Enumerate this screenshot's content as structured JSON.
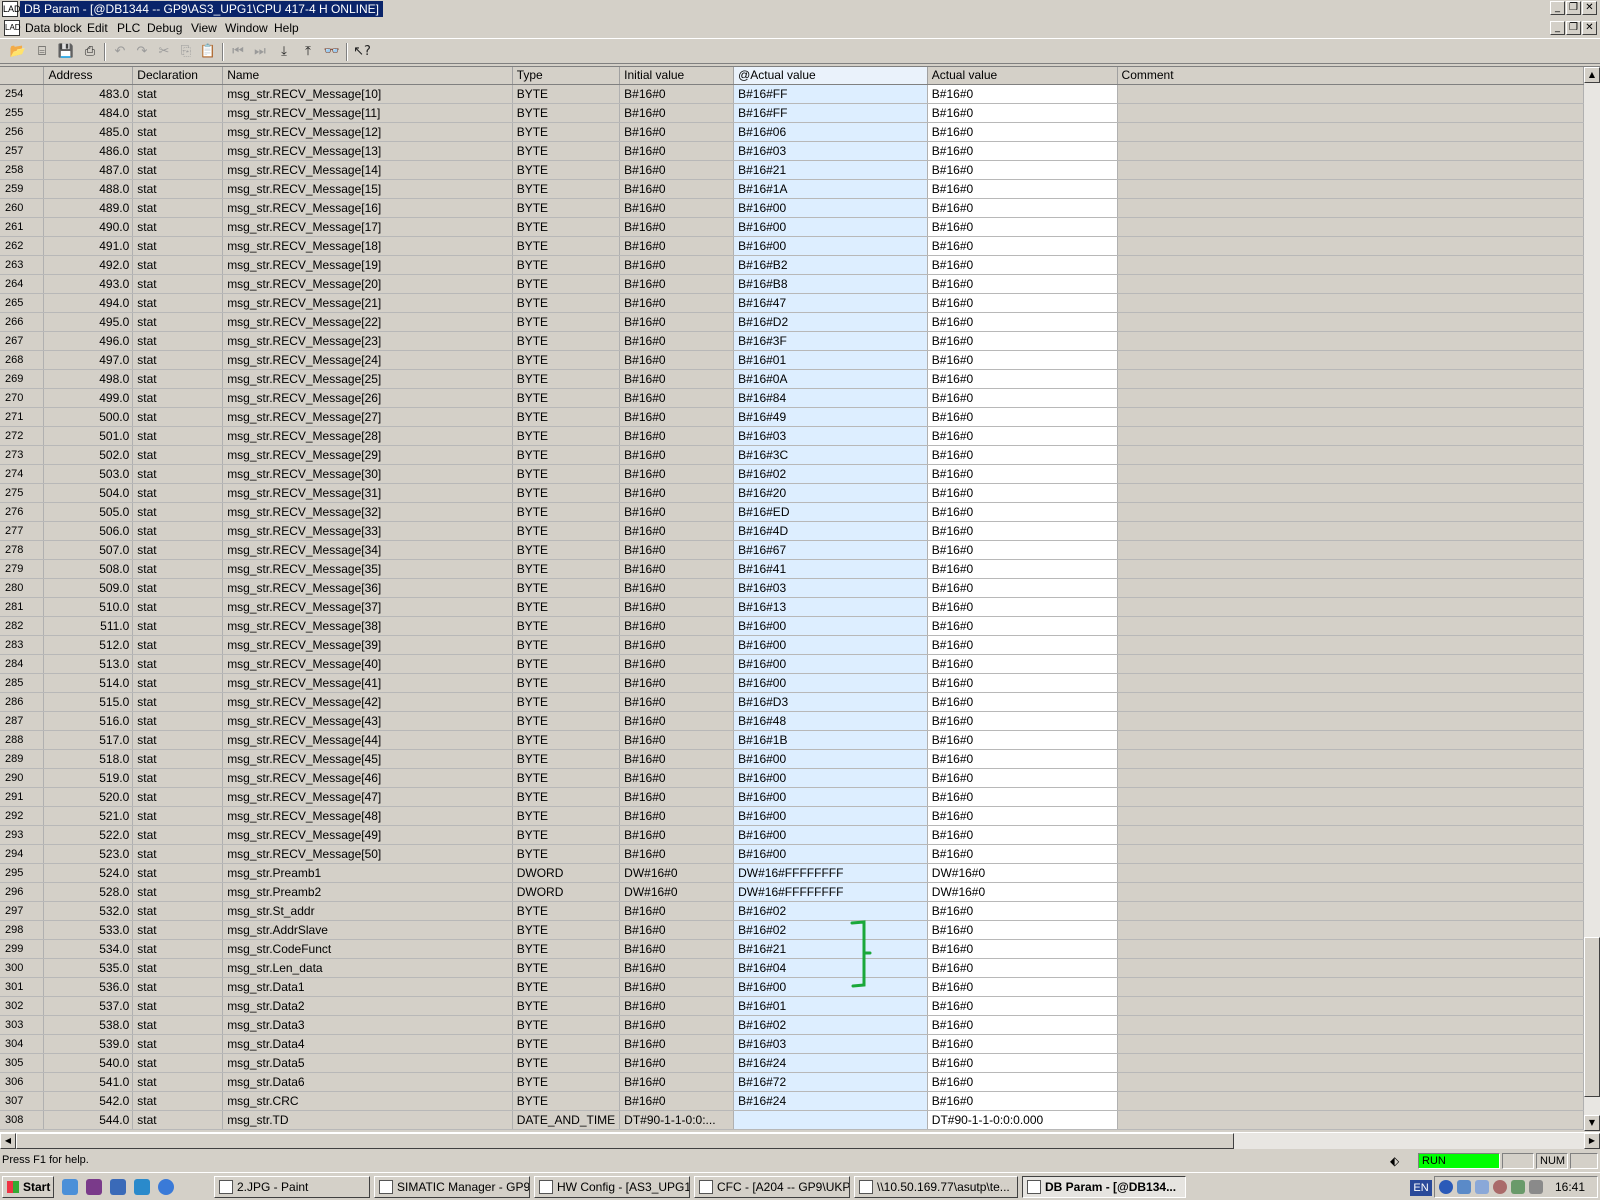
{
  "window": {
    "title": "DB Param - [@DB1344 -- GP9\\AS3_UPG1\\CPU 417-4 H  ONLINE]",
    "app_icon": "LAD-icon"
  },
  "menu": [
    "Data block",
    "Edit",
    "PLC",
    "Debug",
    "View",
    "Window",
    "Help"
  ],
  "columns": {
    "address": "Address",
    "declaration": "Declaration",
    "name": "Name",
    "type": "Type",
    "initial": "Initial value",
    "actual_at": "@Actual value",
    "actual": "Actual value",
    "comment": "Comment"
  },
  "rows": [
    {
      "n": "254",
      "addr": "483.0",
      "decl": "stat",
      "name": "msg_str.RECV_Message[10]",
      "type": "BYTE",
      "init": "B#16#0",
      "act_at": "B#16#FF",
      "act": "B#16#0"
    },
    {
      "n": "255",
      "addr": "484.0",
      "decl": "stat",
      "name": "msg_str.RECV_Message[11]",
      "type": "BYTE",
      "init": "B#16#0",
      "act_at": "B#16#FF",
      "act": "B#16#0"
    },
    {
      "n": "256",
      "addr": "485.0",
      "decl": "stat",
      "name": "msg_str.RECV_Message[12]",
      "type": "BYTE",
      "init": "B#16#0",
      "act_at": "B#16#06",
      "act": "B#16#0"
    },
    {
      "n": "257",
      "addr": "486.0",
      "decl": "stat",
      "name": "msg_str.RECV_Message[13]",
      "type": "BYTE",
      "init": "B#16#0",
      "act_at": "B#16#03",
      "act": "B#16#0"
    },
    {
      "n": "258",
      "addr": "487.0",
      "decl": "stat",
      "name": "msg_str.RECV_Message[14]",
      "type": "BYTE",
      "init": "B#16#0",
      "act_at": "B#16#21",
      "act": "B#16#0"
    },
    {
      "n": "259",
      "addr": "488.0",
      "decl": "stat",
      "name": "msg_str.RECV_Message[15]",
      "type": "BYTE",
      "init": "B#16#0",
      "act_at": "B#16#1A",
      "act": "B#16#0"
    },
    {
      "n": "260",
      "addr": "489.0",
      "decl": "stat",
      "name": "msg_str.RECV_Message[16]",
      "type": "BYTE",
      "init": "B#16#0",
      "act_at": "B#16#00",
      "act": "B#16#0"
    },
    {
      "n": "261",
      "addr": "490.0",
      "decl": "stat",
      "name": "msg_str.RECV_Message[17]",
      "type": "BYTE",
      "init": "B#16#0",
      "act_at": "B#16#00",
      "act": "B#16#0"
    },
    {
      "n": "262",
      "addr": "491.0",
      "decl": "stat",
      "name": "msg_str.RECV_Message[18]",
      "type": "BYTE",
      "init": "B#16#0",
      "act_at": "B#16#00",
      "act": "B#16#0"
    },
    {
      "n": "263",
      "addr": "492.0",
      "decl": "stat",
      "name": "msg_str.RECV_Message[19]",
      "type": "BYTE",
      "init": "B#16#0",
      "act_at": "B#16#B2",
      "act": "B#16#0"
    },
    {
      "n": "264",
      "addr": "493.0",
      "decl": "stat",
      "name": "msg_str.RECV_Message[20]",
      "type": "BYTE",
      "init": "B#16#0",
      "act_at": "B#16#B8",
      "act": "B#16#0"
    },
    {
      "n": "265",
      "addr": "494.0",
      "decl": "stat",
      "name": "msg_str.RECV_Message[21]",
      "type": "BYTE",
      "init": "B#16#0",
      "act_at": "B#16#47",
      "act": "B#16#0"
    },
    {
      "n": "266",
      "addr": "495.0",
      "decl": "stat",
      "name": "msg_str.RECV_Message[22]",
      "type": "BYTE",
      "init": "B#16#0",
      "act_at": "B#16#D2",
      "act": "B#16#0"
    },
    {
      "n": "267",
      "addr": "496.0",
      "decl": "stat",
      "name": "msg_str.RECV_Message[23]",
      "type": "BYTE",
      "init": "B#16#0",
      "act_at": "B#16#3F",
      "act": "B#16#0"
    },
    {
      "n": "268",
      "addr": "497.0",
      "decl": "stat",
      "name": "msg_str.RECV_Message[24]",
      "type": "BYTE",
      "init": "B#16#0",
      "act_at": "B#16#01",
      "act": "B#16#0"
    },
    {
      "n": "269",
      "addr": "498.0",
      "decl": "stat",
      "name": "msg_str.RECV_Message[25]",
      "type": "BYTE",
      "init": "B#16#0",
      "act_at": "B#16#0A",
      "act": "B#16#0"
    },
    {
      "n": "270",
      "addr": "499.0",
      "decl": "stat",
      "name": "msg_str.RECV_Message[26]",
      "type": "BYTE",
      "init": "B#16#0",
      "act_at": "B#16#84",
      "act": "B#16#0"
    },
    {
      "n": "271",
      "addr": "500.0",
      "decl": "stat",
      "name": "msg_str.RECV_Message[27]",
      "type": "BYTE",
      "init": "B#16#0",
      "act_at": "B#16#49",
      "act": "B#16#0"
    },
    {
      "n": "272",
      "addr": "501.0",
      "decl": "stat",
      "name": "msg_str.RECV_Message[28]",
      "type": "BYTE",
      "init": "B#16#0",
      "act_at": "B#16#03",
      "act": "B#16#0"
    },
    {
      "n": "273",
      "addr": "502.0",
      "decl": "stat",
      "name": "msg_str.RECV_Message[29]",
      "type": "BYTE",
      "init": "B#16#0",
      "act_at": "B#16#3C",
      "act": "B#16#0"
    },
    {
      "n": "274",
      "addr": "503.0",
      "decl": "stat",
      "name": "msg_str.RECV_Message[30]",
      "type": "BYTE",
      "init": "B#16#0",
      "act_at": "B#16#02",
      "act": "B#16#0"
    },
    {
      "n": "275",
      "addr": "504.0",
      "decl": "stat",
      "name": "msg_str.RECV_Message[31]",
      "type": "BYTE",
      "init": "B#16#0",
      "act_at": "B#16#20",
      "act": "B#16#0"
    },
    {
      "n": "276",
      "addr": "505.0",
      "decl": "stat",
      "name": "msg_str.RECV_Message[32]",
      "type": "BYTE",
      "init": "B#16#0",
      "act_at": "B#16#ED",
      "act": "B#16#0"
    },
    {
      "n": "277",
      "addr": "506.0",
      "decl": "stat",
      "name": "msg_str.RECV_Message[33]",
      "type": "BYTE",
      "init": "B#16#0",
      "act_at": "B#16#4D",
      "act": "B#16#0"
    },
    {
      "n": "278",
      "addr": "507.0",
      "decl": "stat",
      "name": "msg_str.RECV_Message[34]",
      "type": "BYTE",
      "init": "B#16#0",
      "act_at": "B#16#67",
      "act": "B#16#0"
    },
    {
      "n": "279",
      "addr": "508.0",
      "decl": "stat",
      "name": "msg_str.RECV_Message[35]",
      "type": "BYTE",
      "init": "B#16#0",
      "act_at": "B#16#41",
      "act": "B#16#0"
    },
    {
      "n": "280",
      "addr": "509.0",
      "decl": "stat",
      "name": "msg_str.RECV_Message[36]",
      "type": "BYTE",
      "init": "B#16#0",
      "act_at": "B#16#03",
      "act": "B#16#0"
    },
    {
      "n": "281",
      "addr": "510.0",
      "decl": "stat",
      "name": "msg_str.RECV_Message[37]",
      "type": "BYTE",
      "init": "B#16#0",
      "act_at": "B#16#13",
      "act": "B#16#0"
    },
    {
      "n": "282",
      "addr": "511.0",
      "decl": "stat",
      "name": "msg_str.RECV_Message[38]",
      "type": "BYTE",
      "init": "B#16#0",
      "act_at": "B#16#00",
      "act": "B#16#0"
    },
    {
      "n": "283",
      "addr": "512.0",
      "decl": "stat",
      "name": "msg_str.RECV_Message[39]",
      "type": "BYTE",
      "init": "B#16#0",
      "act_at": "B#16#00",
      "act": "B#16#0"
    },
    {
      "n": "284",
      "addr": "513.0",
      "decl": "stat",
      "name": "msg_str.RECV_Message[40]",
      "type": "BYTE",
      "init": "B#16#0",
      "act_at": "B#16#00",
      "act": "B#16#0"
    },
    {
      "n": "285",
      "addr": "514.0",
      "decl": "stat",
      "name": "msg_str.RECV_Message[41]",
      "type": "BYTE",
      "init": "B#16#0",
      "act_at": "B#16#00",
      "act": "B#16#0"
    },
    {
      "n": "286",
      "addr": "515.0",
      "decl": "stat",
      "name": "msg_str.RECV_Message[42]",
      "type": "BYTE",
      "init": "B#16#0",
      "act_at": "B#16#D3",
      "act": "B#16#0"
    },
    {
      "n": "287",
      "addr": "516.0",
      "decl": "stat",
      "name": "msg_str.RECV_Message[43]",
      "type": "BYTE",
      "init": "B#16#0",
      "act_at": "B#16#48",
      "act": "B#16#0"
    },
    {
      "n": "288",
      "addr": "517.0",
      "decl": "stat",
      "name": "msg_str.RECV_Message[44]",
      "type": "BYTE",
      "init": "B#16#0",
      "act_at": "B#16#1B",
      "act": "B#16#0"
    },
    {
      "n": "289",
      "addr": "518.0",
      "decl": "stat",
      "name": "msg_str.RECV_Message[45]",
      "type": "BYTE",
      "init": "B#16#0",
      "act_at": "B#16#00",
      "act": "B#16#0"
    },
    {
      "n": "290",
      "addr": "519.0",
      "decl": "stat",
      "name": "msg_str.RECV_Message[46]",
      "type": "BYTE",
      "init": "B#16#0",
      "act_at": "B#16#00",
      "act": "B#16#0"
    },
    {
      "n": "291",
      "addr": "520.0",
      "decl": "stat",
      "name": "msg_str.RECV_Message[47]",
      "type": "BYTE",
      "init": "B#16#0",
      "act_at": "B#16#00",
      "act": "B#16#0"
    },
    {
      "n": "292",
      "addr": "521.0",
      "decl": "stat",
      "name": "msg_str.RECV_Message[48]",
      "type": "BYTE",
      "init": "B#16#0",
      "act_at": "B#16#00",
      "act": "B#16#0"
    },
    {
      "n": "293",
      "addr": "522.0",
      "decl": "stat",
      "name": "msg_str.RECV_Message[49]",
      "type": "BYTE",
      "init": "B#16#0",
      "act_at": "B#16#00",
      "act": "B#16#0"
    },
    {
      "n": "294",
      "addr": "523.0",
      "decl": "stat",
      "name": "msg_str.RECV_Message[50]",
      "type": "BYTE",
      "init": "B#16#0",
      "act_at": "B#16#00",
      "act": "B#16#0"
    },
    {
      "n": "295",
      "addr": "524.0",
      "decl": "stat",
      "name": "msg_str.Preamb1",
      "type": "DWORD",
      "init": "DW#16#0",
      "act_at": "DW#16#FFFFFFFF",
      "act": "DW#16#0"
    },
    {
      "n": "296",
      "addr": "528.0",
      "decl": "stat",
      "name": "msg_str.Preamb2",
      "type": "DWORD",
      "init": "DW#16#0",
      "act_at": "DW#16#FFFFFFFF",
      "act": "DW#16#0"
    },
    {
      "n": "297",
      "addr": "532.0",
      "decl": "stat",
      "name": "msg_str.St_addr",
      "type": "BYTE",
      "init": "B#16#0",
      "act_at": "B#16#02",
      "act": "B#16#0"
    },
    {
      "n": "298",
      "addr": "533.0",
      "decl": "stat",
      "name": "msg_str.AddrSlave",
      "type": "BYTE",
      "init": "B#16#0",
      "act_at": "B#16#02",
      "act": "B#16#0"
    },
    {
      "n": "299",
      "addr": "534.0",
      "decl": "stat",
      "name": "msg_str.CodeFunct",
      "type": "BYTE",
      "init": "B#16#0",
      "act_at": "B#16#21",
      "act": "B#16#0"
    },
    {
      "n": "300",
      "addr": "535.0",
      "decl": "stat",
      "name": "msg_str.Len_data",
      "type": "BYTE",
      "init": "B#16#0",
      "act_at": "B#16#04",
      "act": "B#16#0"
    },
    {
      "n": "301",
      "addr": "536.0",
      "decl": "stat",
      "name": "msg_str.Data1",
      "type": "BYTE",
      "init": "B#16#0",
      "act_at": "B#16#00",
      "act": "B#16#0"
    },
    {
      "n": "302",
      "addr": "537.0",
      "decl": "stat",
      "name": "msg_str.Data2",
      "type": "BYTE",
      "init": "B#16#0",
      "act_at": "B#16#01",
      "act": "B#16#0"
    },
    {
      "n": "303",
      "addr": "538.0",
      "decl": "stat",
      "name": "msg_str.Data3",
      "type": "BYTE",
      "init": "B#16#0",
      "act_at": "B#16#02",
      "act": "B#16#0"
    },
    {
      "n": "304",
      "addr": "539.0",
      "decl": "stat",
      "name": "msg_str.Data4",
      "type": "BYTE",
      "init": "B#16#0",
      "act_at": "B#16#03",
      "act": "B#16#0"
    },
    {
      "n": "305",
      "addr": "540.0",
      "decl": "stat",
      "name": "msg_str.Data5",
      "type": "BYTE",
      "init": "B#16#0",
      "act_at": "B#16#24",
      "act": "B#16#0"
    },
    {
      "n": "306",
      "addr": "541.0",
      "decl": "stat",
      "name": "msg_str.Data6",
      "type": "BYTE",
      "init": "B#16#0",
      "act_at": "B#16#72",
      "act": "B#16#0"
    },
    {
      "n": "307",
      "addr": "542.0",
      "decl": "stat",
      "name": "msg_str.CRC",
      "type": "BYTE",
      "init": "B#16#0",
      "act_at": "B#16#24",
      "act": "B#16#0"
    },
    {
      "n": "308",
      "addr": "544.0",
      "decl": "stat",
      "name": "msg_str.TD",
      "type": "DATE_AND_TIME",
      "init": "DT#90-1-1-0:0:...",
      "act_at": "",
      "act": "DT#90-1-1-0:0:0.000"
    }
  ],
  "annotation_color": "#1aa83a",
  "status": {
    "help": "Press F1 for help.",
    "run": "RUN",
    "run_color": "#00ff00",
    "num": "NUM"
  },
  "taskbar": {
    "start": "Start",
    "tasks": [
      {
        "label": "2.JPG - Paint"
      },
      {
        "label": "SIMATIC Manager - GP9"
      },
      {
        "label": "HW Config - [AS3_UPG1 ..."
      },
      {
        "label": "CFC - [A204 -- GP9\\UKP..."
      },
      {
        "label": "\\\\10.50.169.77\\asutp\\te..."
      },
      {
        "label": "DB Param - [@DB134..."
      }
    ],
    "lang": "EN",
    "clock": "16:41"
  }
}
